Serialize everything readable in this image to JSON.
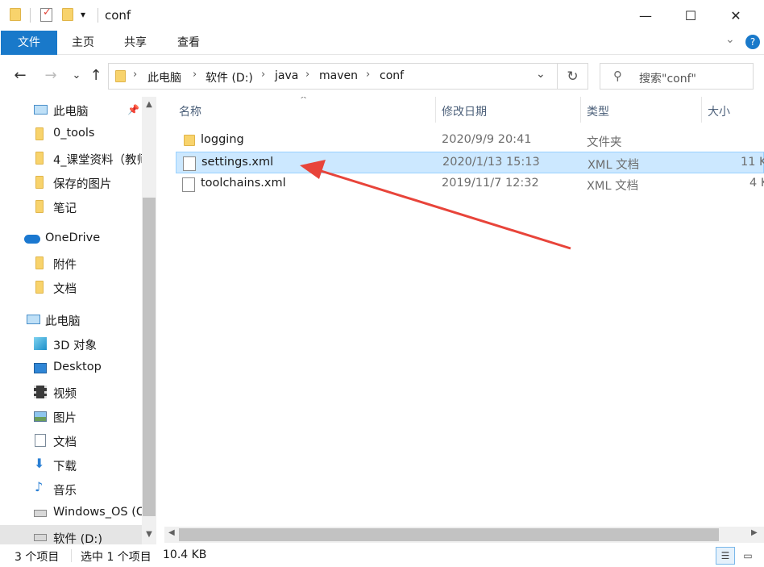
{
  "window": {
    "title": "conf",
    "controls": {
      "minimize": "—",
      "maximize": "☐",
      "close": "✕"
    }
  },
  "quick_access": {
    "dropdown": "▾"
  },
  "ribbon": {
    "tabs": [
      "文件",
      "主页",
      "共享",
      "查看"
    ],
    "collapse_glyph": "⌄",
    "help_glyph": "?"
  },
  "navigation": {
    "back": "←",
    "forward": "→",
    "recent": "⌄",
    "up": "↑",
    "breadcrumb": [
      "此电脑",
      "软件 (D:)",
      "java",
      "maven",
      "conf"
    ],
    "crumb_sep": "›",
    "dropdown": "⌄",
    "refresh": "↻"
  },
  "search": {
    "icon": "⚲",
    "placeholder": "搜索\"conf\""
  },
  "sidebar": {
    "items": [
      {
        "label": "此电脑",
        "icon": "pc-icon",
        "pinned": true
      },
      {
        "label": "0_tools",
        "icon": "folder-icon"
      },
      {
        "label": "4_课堂资料（教师",
        "icon": "folder-icon"
      },
      {
        "label": "保存的图片",
        "icon": "folder-icon"
      },
      {
        "label": "笔记",
        "icon": "folder-icon"
      },
      {
        "label": "OneDrive",
        "icon": "cloud-icon"
      },
      {
        "label": "附件",
        "icon": "folder-icon"
      },
      {
        "label": "文档",
        "icon": "folder-icon"
      },
      {
        "label": "此电脑",
        "icon": "pc-icon"
      },
      {
        "label": "3D 对象",
        "icon": "cube-icon"
      },
      {
        "label": "Desktop",
        "icon": "desktop-icon"
      },
      {
        "label": "视频",
        "icon": "video-icon"
      },
      {
        "label": "图片",
        "icon": "picture-icon"
      },
      {
        "label": "文档",
        "icon": "document-icon"
      },
      {
        "label": "下载",
        "icon": "download-icon"
      },
      {
        "label": "音乐",
        "icon": "music-icon"
      },
      {
        "label": "Windows_OS (C",
        "icon": "drive-icon"
      },
      {
        "label": "软件 (D:)",
        "icon": "drive-icon"
      }
    ],
    "pin_glyph": "📌"
  },
  "columns": {
    "name": "名称",
    "date": "修改日期",
    "type": "类型",
    "size": "大小"
  },
  "files": [
    {
      "name": "logging",
      "date": "2020/9/9 20:41",
      "type": "文件夹",
      "size": "",
      "kind": "folder",
      "selected": false
    },
    {
      "name": "settings.xml",
      "date": "2020/1/13 15:13",
      "type": "XML 文档",
      "size": "11 K",
      "kind": "file",
      "selected": true
    },
    {
      "name": "toolchains.xml",
      "date": "2019/11/7 12:32",
      "type": "XML 文档",
      "size": "4 K",
      "kind": "file",
      "selected": false
    }
  ],
  "statusbar": {
    "count": "3 个项目",
    "selection": "选中 1 个项目",
    "size": "10.4 KB"
  },
  "colors": {
    "accent": "#1979ca",
    "selection": "#cce8ff",
    "annotation_arrow": "#e8443a"
  }
}
